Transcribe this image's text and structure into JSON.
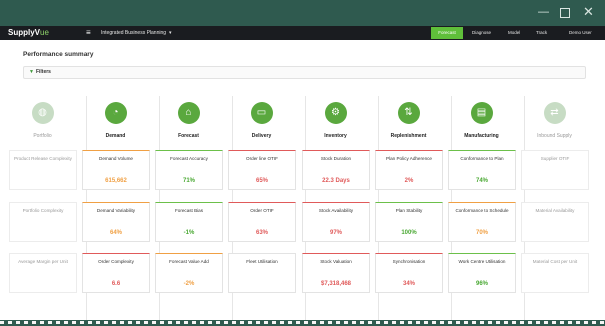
{
  "window": {
    "min_icon": "minimize-icon",
    "max_icon": "maximize-icon",
    "close_icon": "close-icon",
    "min_glyph": "—",
    "close_glyph": "✕"
  },
  "navbar": {
    "logo_main": "SupplyV",
    "logo_suffix": "ue",
    "menu_glyph": "≡",
    "app_title": "Integrated Business Planning",
    "app_title_caret": "▾",
    "buttons": [
      {
        "label": "Forecast",
        "icon": "forecast-icon",
        "active": true
      },
      {
        "label": "Diagnose",
        "icon": "diagnose-icon",
        "active": false
      },
      {
        "label": "Model",
        "icon": "model-icon",
        "active": false
      },
      {
        "label": "Track",
        "icon": "track-icon",
        "active": false
      },
      {
        "label": "Demo User",
        "icon": "user-caret-icon",
        "active": false
      }
    ],
    "accent_color": "#5fbf3a"
  },
  "page": {
    "title": "Performance summary",
    "filters_label": "Filters",
    "filters_glyph": "▼"
  },
  "categories": [
    {
      "label": "Portfolio",
      "icon": "portfolio-icon",
      "glyph": "◍",
      "faded": true
    },
    {
      "label": "Demand",
      "icon": "demand-icon",
      "glyph": "◔",
      "faded": false
    },
    {
      "label": "Forecast",
      "icon": "forecast-icon",
      "glyph": "⌂",
      "faded": false
    },
    {
      "label": "Delivery",
      "icon": "delivery-icon",
      "glyph": "▭",
      "faded": false
    },
    {
      "label": "Inventory",
      "icon": "inventory-icon",
      "glyph": "⚙",
      "faded": false
    },
    {
      "label": "Replenishment",
      "icon": "replenishment-icon",
      "glyph": "⇅",
      "faded": false
    },
    {
      "label": "Manufacturing",
      "icon": "manufacturing-icon",
      "glyph": "▤",
      "faded": false
    },
    {
      "label": "Inbound Supply",
      "icon": "inbound-supply-icon",
      "glyph": "⇄",
      "faded": true
    }
  ],
  "cards": [
    [
      {
        "label": "Product Release Complexity",
        "value": "",
        "tone": "faded"
      },
      {
        "label": "Portfolio Complexity",
        "value": "",
        "tone": "faded"
      },
      {
        "label": "Average Margin per Unit",
        "value": "",
        "tone": "faded"
      }
    ],
    [
      {
        "label": "Demand Volume",
        "value": "615,662",
        "tone": "orange"
      },
      {
        "label": "Demand Variability",
        "value": "64%",
        "tone": "orange"
      },
      {
        "label": "Order Complexity",
        "value": "6.6",
        "tone": "red"
      }
    ],
    [
      {
        "label": "Forecast Accuracy",
        "value": "71%",
        "tone": "green"
      },
      {
        "label": "Forecast Bias",
        "value": "-1%",
        "tone": "green"
      },
      {
        "label": "Forecast Value Add",
        "value": "-2%",
        "tone": "orange"
      }
    ],
    [
      {
        "label": "Order line OTIF",
        "value": "65%",
        "tone": "red"
      },
      {
        "label": "Order OTIF",
        "value": "63%",
        "tone": "red"
      },
      {
        "label": "Fleet Utilisation",
        "value": "",
        "tone": "plain"
      }
    ],
    [
      {
        "label": "Stock Duration",
        "value": "22.3 Days",
        "tone": "red"
      },
      {
        "label": "Stock Availability",
        "value": "97%",
        "tone": "red"
      },
      {
        "label": "Stock Valuation",
        "value": "$7,318,468",
        "tone": "red"
      }
    ],
    [
      {
        "label": "Plan Policy Adherence",
        "value": "2%",
        "tone": "red"
      },
      {
        "label": "Plan Stability",
        "value": "100%",
        "tone": "green"
      },
      {
        "label": "Synchronisation",
        "value": "34%",
        "tone": "red"
      }
    ],
    [
      {
        "label": "Conformance to Plan",
        "value": "74%",
        "tone": "green"
      },
      {
        "label": "Conformance to Schedule",
        "value": "70%",
        "tone": "orange"
      },
      {
        "label": "Work Centre Utilisation",
        "value": "96%",
        "tone": "green"
      }
    ],
    [
      {
        "label": "Supplier OTIF",
        "value": "",
        "tone": "faded"
      },
      {
        "label": "Material Availability",
        "value": "",
        "tone": "faded"
      },
      {
        "label": "Material Cost per Unit",
        "value": "",
        "tone": "faded"
      }
    ]
  ]
}
